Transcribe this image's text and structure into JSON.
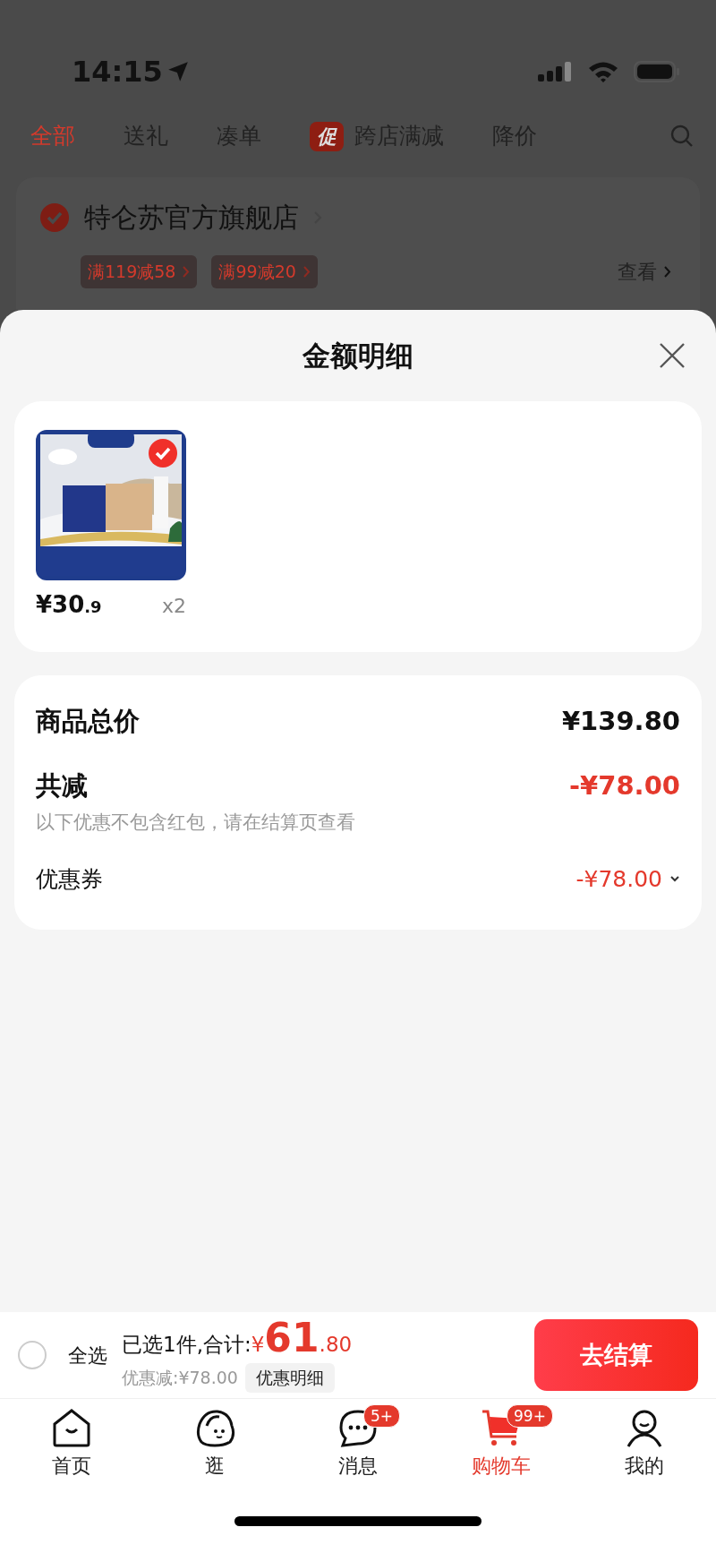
{
  "status_bar": {
    "time": "14:15"
  },
  "filter_tabs": [
    {
      "label": "全部",
      "selected": true
    },
    {
      "label": "送礼",
      "selected": false
    },
    {
      "label": "凑单",
      "selected": false
    },
    {
      "label": "跨店满减",
      "selected": false,
      "badge": "促"
    },
    {
      "label": "降价",
      "selected": false
    }
  ],
  "store": {
    "name": "特仑苏官方旗舰店",
    "checked": true,
    "promos": [
      "满119减58",
      "满99减20"
    ],
    "view_link": "查看"
  },
  "sheet": {
    "title": "金额明细",
    "items": [
      {
        "kind": "picture",
        "price": "¥30",
        "price_decimal": ".9",
        "quantity": "x2",
        "selected": true
      }
    ],
    "summary": {
      "total_label": "商品总价",
      "total": "¥139.80",
      "discount_label": "共减",
      "discount": "-¥78.00",
      "note": "以下优惠不包含红包，请在结算页查看",
      "coupon_label": "优惠券",
      "coupon_value": "-¥78.00",
      "coupon_expanded": false
    }
  },
  "bottom_bar": {
    "select_all": {
      "label": "全选",
      "checked": false
    },
    "summary_text": "已选1件,合计:",
    "currency": "¥",
    "amount": "61",
    "amount_decimal": ".80",
    "discount_text": "优惠减:¥78.00",
    "detail_button": "优惠明细",
    "checkout_button": "去结算"
  },
  "tab_bar": [
    {
      "kind": "home",
      "label": "首页",
      "selected": false
    },
    {
      "kind": "explore",
      "label": "逛",
      "selected": false
    },
    {
      "kind": "message",
      "label": "消息",
      "selected": false,
      "badge": "5+"
    },
    {
      "kind": "cart",
      "label": "购物车",
      "selected": true,
      "badge": "99+"
    },
    {
      "kind": "profile",
      "label": "我的",
      "selected": false
    }
  ]
}
